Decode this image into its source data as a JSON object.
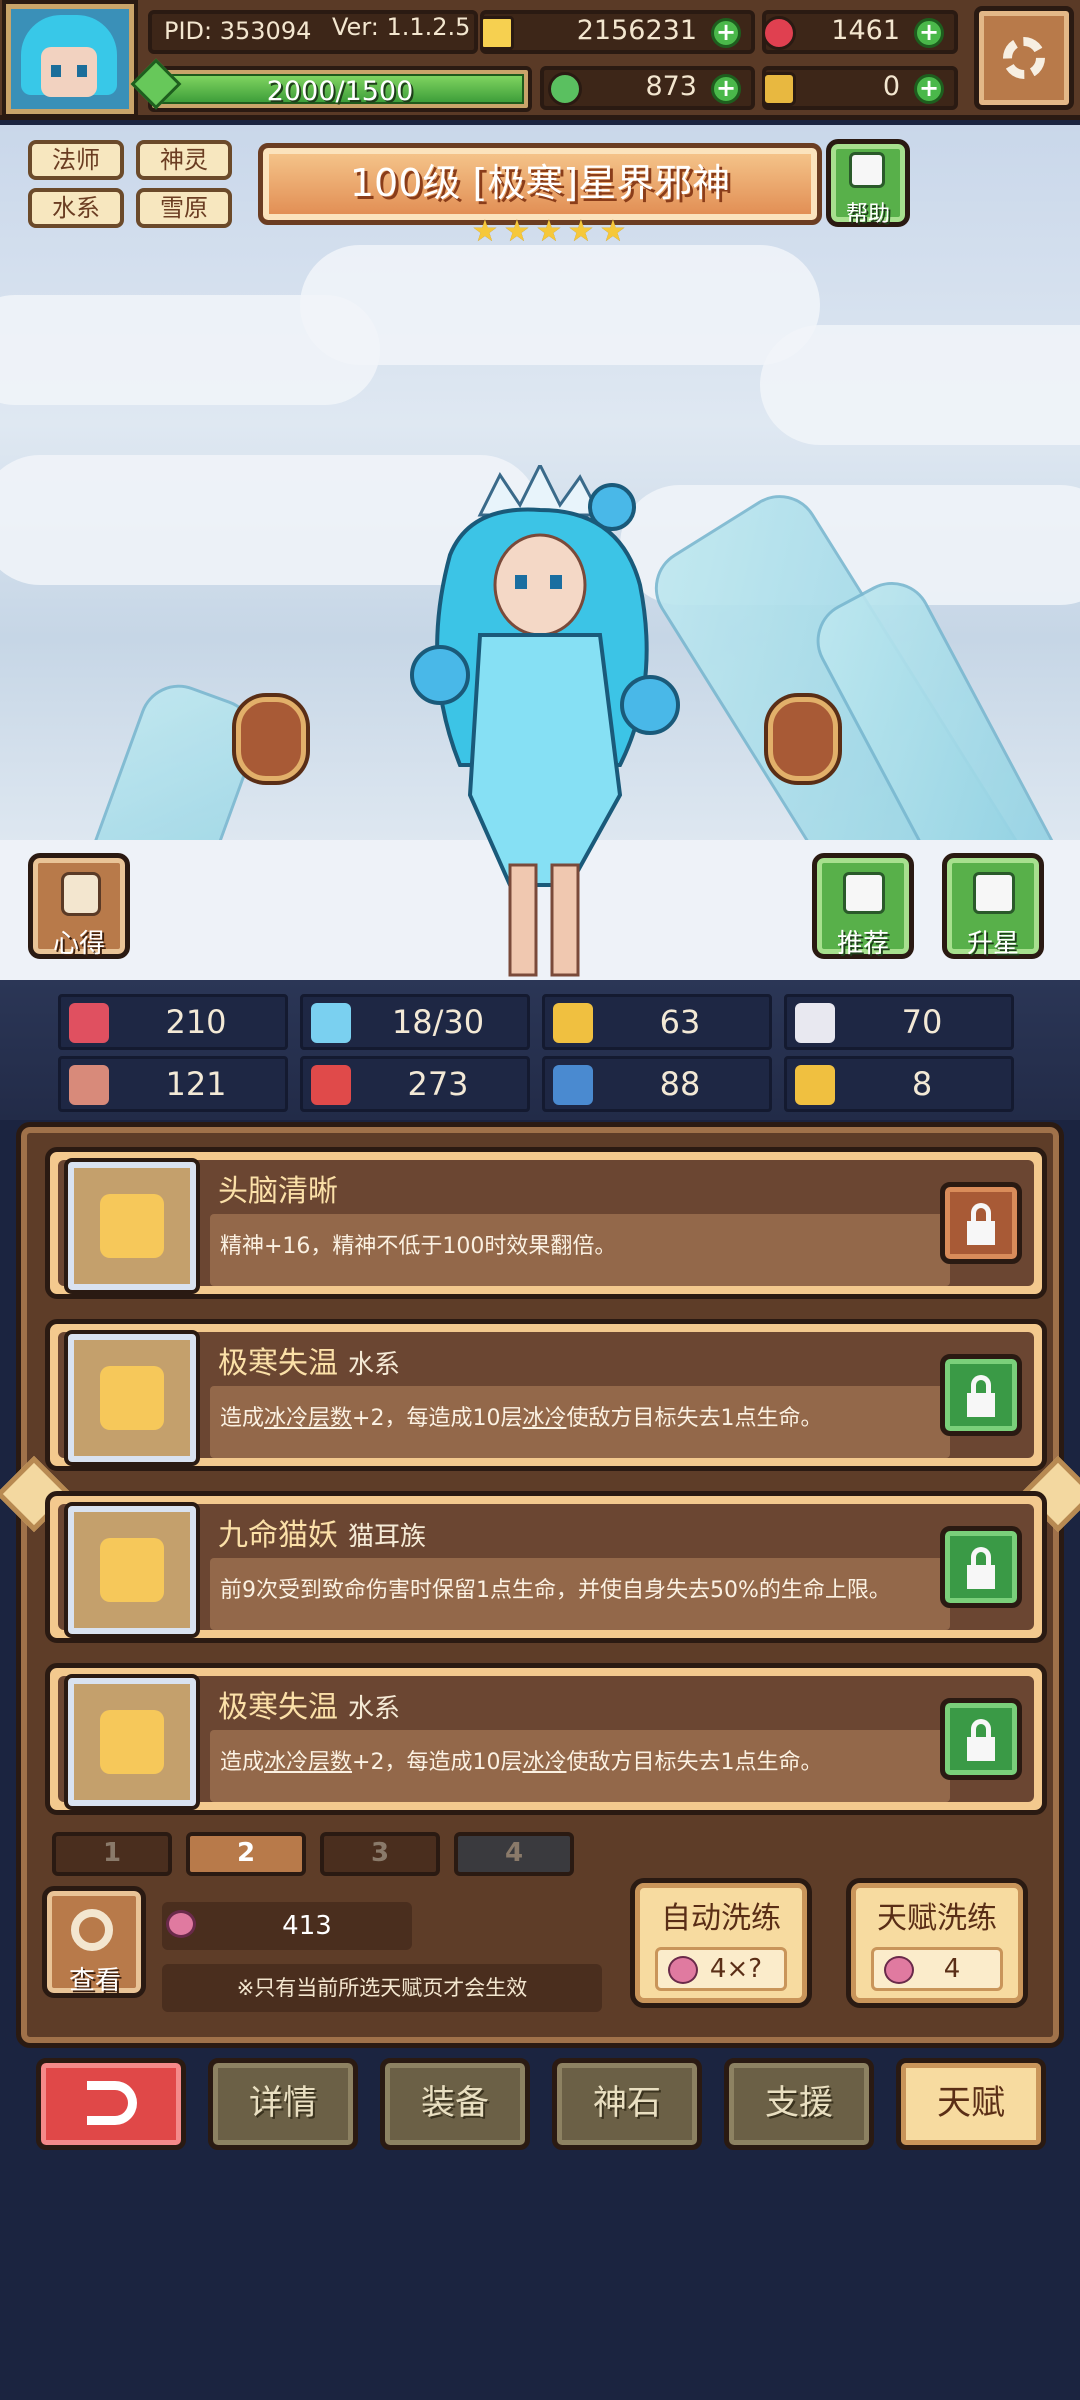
{
  "topbar": {
    "pid": "PID: 353094",
    "version": "Ver: 1.1.2.5",
    "gold": "2156231",
    "gems": "1461",
    "energy": "2000/1500",
    "energy_fraction": 1.0,
    "clover": "873",
    "potion": "0",
    "plus": "+"
  },
  "hero": {
    "tags": [
      "法师",
      "神灵",
      "水系",
      "雪原"
    ],
    "title": "100级 [极寒]星界邪神",
    "stars": 5,
    "help_label": "帮助",
    "insight_label": "心得",
    "recommend_label": "推荐",
    "starup_label": "升星"
  },
  "stats": [
    {
      "icon": "heart-icon",
      "value": "210",
      "color": "#e05060"
    },
    {
      "icon": "mana-drop-icon",
      "value": "18/30",
      "color": "#7ad0f0"
    },
    {
      "icon": "shield-icon",
      "value": "63",
      "color": "#f0c040"
    },
    {
      "icon": "wing-icon",
      "value": "70",
      "color": "#e8e8f0"
    },
    {
      "icon": "fist-icon",
      "value": "121",
      "color": "#d88a7a"
    },
    {
      "icon": "spellbook-icon",
      "value": "273",
      "color": "#e04a4a"
    },
    {
      "icon": "boot-icon",
      "value": "88",
      "color": "#4a8ad0"
    },
    {
      "icon": "horseshoe-icon",
      "value": "8",
      "color": "#f0c040"
    }
  ],
  "talents": [
    {
      "name": "头脑清晰",
      "tag": "",
      "desc_parts": [
        "精神+16，精神不低于100时效果翻倍。"
      ],
      "locked": false
    },
    {
      "name": "极寒失温",
      "tag": "水系",
      "desc_parts": [
        "造成",
        "冰冷层数",
        "+2，每造成10层",
        "冰冷",
        "使敌方目标失去1点生命。"
      ],
      "locked": true
    },
    {
      "name": "九命猫妖",
      "tag": "猫耳族",
      "desc_parts": [
        "前9次受到致命伤害时保留1点生命，并使自身失去50%的生命上限。"
      ],
      "locked": true
    },
    {
      "name": "极寒失温",
      "tag": "水系",
      "desc_parts": [
        "造成",
        "冰冷层数",
        "+2，每造成10层",
        "冰冷",
        "使敌方目标失去1点生命。"
      ],
      "locked": true
    }
  ],
  "pages": [
    "1",
    "2",
    "3",
    "4"
  ],
  "active_page": "2",
  "bottom": {
    "view_label": "查看",
    "peach_count": "413",
    "note": "※只有当前所选天赋页才会生效",
    "auto_wash_title": "自动洗练",
    "auto_wash_cost": "4×?",
    "talent_wash_title": "天赋洗练",
    "talent_wash_cost": "4"
  },
  "nav": [
    "详情",
    "装备",
    "神石",
    "支援",
    "天赋"
  ],
  "nav_active": "天赋"
}
